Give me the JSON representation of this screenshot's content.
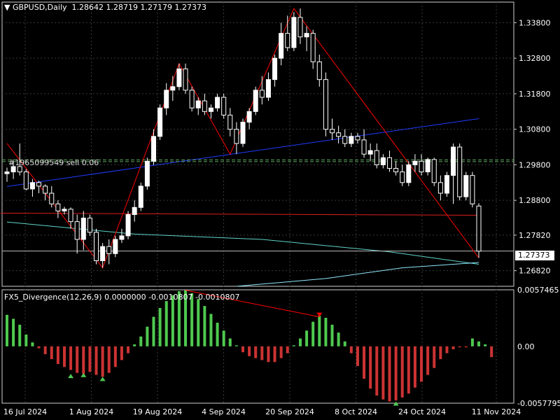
{
  "header": {
    "symbol_label": "GBPUSD,Daily",
    "ohlc": "1.28642 1.28719 1.27179 1.27373",
    "order_label": "#1965099549 sell 0.06"
  },
  "indicator": {
    "label": "FX5_Divergence(12,26,9) 0.0000000 -0.0010807 -0.0010807",
    "levels": [
      "0.0057465",
      "0.00",
      "-0.0057795"
    ]
  },
  "current_price": "1.27373",
  "colors": {
    "background": "#000000",
    "grid": "#3a3a3a",
    "candle": "#ffffff",
    "zigzag": "#ff0000",
    "trend_blue": "#1e3cff",
    "ma_red": "#dc1e1e",
    "ma_cyan": "#5fd3c8",
    "osc_pos": "#4fc94f",
    "osc_neg": "#cc3333"
  },
  "chart_data": {
    "type": "candlestick",
    "y_ticks": [
      "1.33800",
      "1.32800",
      "1.31800",
      "1.30800",
      "1.29800",
      "1.28800",
      "1.27820",
      "1.26820"
    ],
    "x_ticks": [
      "16 Jul 2024",
      "1 Aug 2024",
      "19 Aug 2024",
      "4 Sep 2024",
      "20 Sep 2024",
      "8 Oct 2024",
      "24 Oct 2024",
      "11 Nov 2024"
    ],
    "ylim": [
      1.2638,
      1.3438
    ],
    "ohlc": [
      [
        1.2955,
        1.2972,
        1.2932,
        1.296
      ],
      [
        1.296,
        1.299,
        1.294,
        1.2975
      ],
      [
        1.2975,
        1.304,
        1.295,
        1.296
      ],
      [
        1.296,
        1.2968,
        1.2908,
        1.2912
      ],
      [
        1.2912,
        1.294,
        1.289,
        1.293
      ],
      [
        1.293,
        1.2935,
        1.29,
        1.292
      ],
      [
        1.292,
        1.2925,
        1.288,
        1.29
      ],
      [
        1.29,
        1.292,
        1.286,
        1.287
      ],
      [
        1.287,
        1.288,
        1.283,
        1.285
      ],
      [
        1.285,
        1.2862,
        1.284,
        1.2855
      ],
      [
        1.2855,
        1.286,
        1.28,
        1.282
      ],
      [
        1.282,
        1.284,
        1.273,
        1.277
      ],
      [
        1.277,
        1.285,
        1.274,
        1.283
      ],
      [
        1.283,
        1.284,
        1.278,
        1.279
      ],
      [
        1.279,
        1.28,
        1.27,
        1.271
      ],
      [
        1.271,
        1.276,
        1.269,
        1.275
      ],
      [
        1.275,
        1.277,
        1.27,
        1.273
      ],
      [
        1.273,
        1.278,
        1.272,
        1.277
      ],
      [
        1.277,
        1.28,
        1.276,
        1.278
      ],
      [
        1.278,
        1.285,
        1.277,
        1.284
      ],
      [
        1.284,
        1.288,
        1.282,
        1.286
      ],
      [
        1.286,
        1.293,
        1.285,
        1.292
      ],
      [
        1.292,
        1.3,
        1.291,
        1.299
      ],
      [
        1.299,
        1.308,
        1.298,
        1.306
      ],
      [
        1.306,
        1.315,
        1.305,
        1.314
      ],
      [
        1.314,
        1.321,
        1.312,
        1.319
      ],
      [
        1.319,
        1.323,
        1.316,
        1.32
      ],
      [
        1.32,
        1.3265,
        1.319,
        1.325
      ],
      [
        1.325,
        1.3265,
        1.318,
        1.319
      ],
      [
        1.319,
        1.32,
        1.313,
        1.314
      ],
      [
        1.314,
        1.317,
        1.312,
        1.316
      ],
      [
        1.316,
        1.318,
        1.312,
        1.313
      ],
      [
        1.313,
        1.315,
        1.311,
        1.314
      ],
      [
        1.314,
        1.318,
        1.313,
        1.317
      ],
      [
        1.317,
        1.318,
        1.311,
        1.312
      ],
      [
        1.312,
        1.314,
        1.306,
        1.308
      ],
      [
        1.308,
        1.31,
        1.301,
        1.304
      ],
      [
        1.304,
        1.311,
        1.303,
        1.31
      ],
      [
        1.31,
        1.314,
        1.308,
        1.313
      ],
      [
        1.313,
        1.32,
        1.312,
        1.319
      ],
      [
        1.319,
        1.323,
        1.315,
        1.317
      ],
      [
        1.317,
        1.324,
        1.316,
        1.322
      ],
      [
        1.322,
        1.329,
        1.32,
        1.328
      ],
      [
        1.328,
        1.338,
        1.326,
        1.335
      ],
      [
        1.335,
        1.34,
        1.33,
        1.331
      ],
      [
        1.331,
        1.341,
        1.33,
        1.3395
      ],
      [
        1.3395,
        1.342,
        1.332,
        1.334
      ],
      [
        1.334,
        1.337,
        1.33,
        1.335
      ],
      [
        1.335,
        1.336,
        1.325,
        1.327
      ],
      [
        1.327,
        1.329,
        1.32,
        1.322
      ],
      [
        1.322,
        1.324,
        1.306,
        1.308
      ],
      [
        1.308,
        1.311,
        1.305,
        1.307
      ],
      [
        1.307,
        1.309,
        1.304,
        1.306
      ],
      [
        1.306,
        1.308,
        1.303,
        1.304
      ],
      [
        1.304,
        1.307,
        1.303,
        1.306
      ],
      [
        1.306,
        1.307,
        1.304,
        1.305
      ],
      [
        1.305,
        1.308,
        1.3,
        1.301
      ],
      [
        1.301,
        1.304,
        1.299,
        1.302
      ],
      [
        1.302,
        1.304,
        1.297,
        1.298
      ],
      [
        1.298,
        1.301,
        1.297,
        1.3
      ],
      [
        1.3,
        1.302,
        1.296,
        1.297
      ],
      [
        1.297,
        1.299,
        1.295,
        1.296
      ],
      [
        1.296,
        1.298,
        1.292,
        1.293
      ],
      [
        1.293,
        1.299,
        1.292,
        1.298
      ],
      [
        1.298,
        1.301,
        1.296,
        1.299
      ],
      [
        1.299,
        1.301,
        1.295,
        1.296
      ],
      [
        1.296,
        1.3,
        1.295,
        1.2995
      ],
      [
        1.2995,
        1.3,
        1.292,
        1.293
      ],
      [
        1.293,
        1.295,
        1.288,
        1.29
      ],
      [
        1.29,
        1.296,
        1.289,
        1.295
      ],
      [
        1.295,
        1.304,
        1.287,
        1.303
      ],
      [
        1.303,
        1.304,
        1.288,
        1.289
      ],
      [
        1.289,
        1.296,
        1.288,
        1.295
      ],
      [
        1.295,
        1.296,
        1.286,
        1.287
      ],
      [
        1.2864,
        1.2872,
        1.2718,
        1.2737
      ]
    ],
    "oscillator": [
      0.0032,
      0.0028,
      0.0022,
      0.0012,
      0.0004,
      -0.0002,
      -0.0008,
      -0.0013,
      -0.0018,
      -0.0021,
      -0.0024,
      -0.0027,
      -0.0028,
      -0.0026,
      -0.0029,
      -0.0031,
      -0.0027,
      -0.0021,
      -0.0014,
      -0.0007,
      0.0002,
      0.001,
      0.002,
      0.003,
      0.0039,
      0.0046,
      0.0052,
      0.0056,
      0.0057,
      0.0054,
      0.0048,
      0.0041,
      0.0033,
      0.0024,
      0.0016,
      0.0008,
      0.0001,
      -0.0006,
      -0.001,
      -0.0012,
      -0.0014,
      -0.0016,
      -0.0016,
      -0.0012,
      -0.0007,
      0.0001,
      0.0008,
      0.0016,
      0.0025,
      0.0031,
      0.0029,
      0.0022,
      0.0014,
      0.0005,
      -0.0007,
      -0.002,
      -0.0033,
      -0.0043,
      -0.005,
      -0.0054,
      -0.0056,
      -0.0055,
      -0.0052,
      -0.0048,
      -0.0042,
      -0.0036,
      -0.0029,
      -0.0022,
      -0.0013,
      -0.0007,
      -0.0003,
      -0.0001,
      -0.0001,
      0.0008,
      0.0005,
      0.0002,
      -0.0011
    ]
  }
}
